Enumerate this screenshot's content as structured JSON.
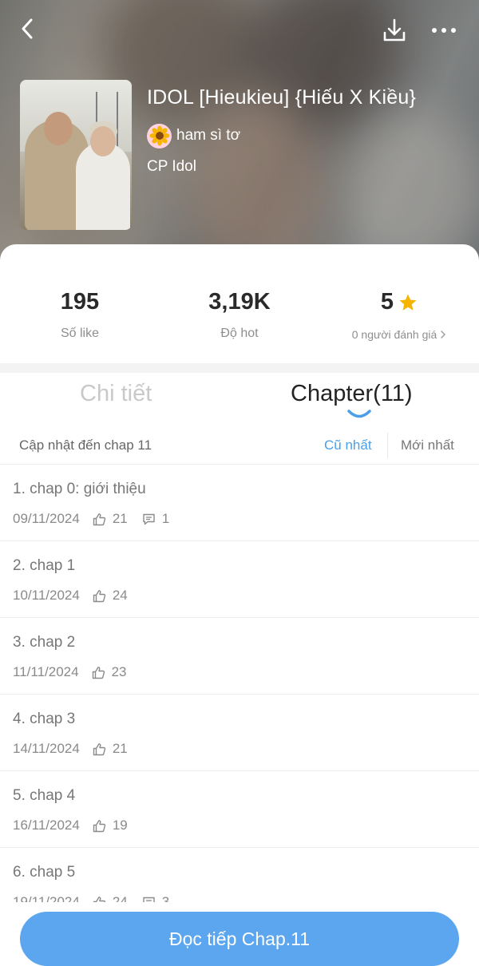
{
  "header": {
    "title": "IDOL [Hieukieu] {Hiếu X Kiều}",
    "author": "ham sì tơ",
    "author_avatar_icon": "sunflower-icon",
    "category": "CP Idol"
  },
  "stats": {
    "likes": {
      "value": "195",
      "label": "Số like"
    },
    "hot": {
      "value": "3,19K",
      "label": "Độ hot"
    },
    "rating": {
      "value": "5",
      "label": "0 người đánh giá",
      "icon": "star-icon",
      "star_color": "#f5b400"
    }
  },
  "tabs": [
    {
      "label": "Chi tiết",
      "active": false
    },
    {
      "label": "Chapter(11)",
      "active": true
    }
  ],
  "update_info": "Cập nhật đến chap 11",
  "sort": {
    "oldest": "Cũ nhất",
    "newest": "Mới nhất",
    "selected": "Cũ nhất"
  },
  "chapters": [
    {
      "title": "1. chap 0: giới thiệu",
      "date": "09/11/2024",
      "likes": "21",
      "comments": "1"
    },
    {
      "title": "2. chap 1",
      "date": "10/11/2024",
      "likes": "24",
      "comments": null
    },
    {
      "title": "3. chap 2",
      "date": "11/11/2024",
      "likes": "23",
      "comments": null
    },
    {
      "title": "4. chap 3",
      "date": "14/11/2024",
      "likes": "21",
      "comments": null
    },
    {
      "title": "5. chap 4",
      "date": "16/11/2024",
      "likes": "19",
      "comments": null
    },
    {
      "title": "6. chap 5",
      "date": "19/11/2024",
      "likes": "24",
      "comments": "3"
    }
  ],
  "cta": {
    "label": "Đọc tiếp Chap.11"
  },
  "colors": {
    "accent": "#4a9fe8",
    "cta": "#5ba6ee",
    "star": "#f5b400"
  }
}
